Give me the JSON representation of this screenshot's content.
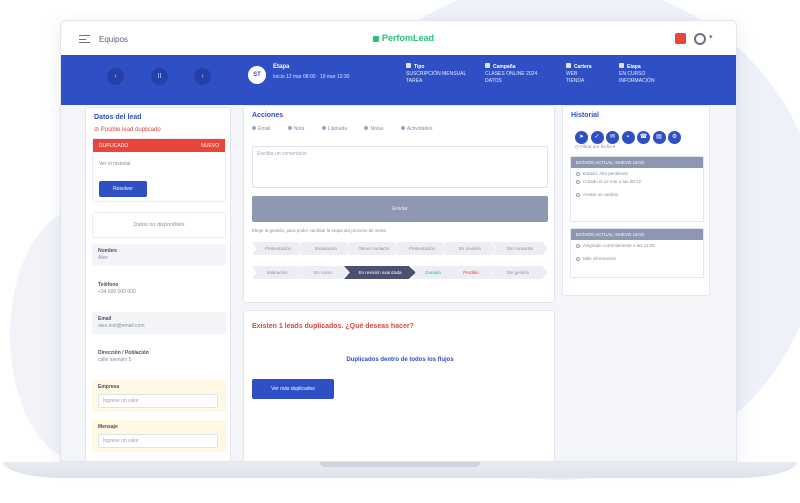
{
  "topbar": {
    "section_title": "Equipos",
    "logo": "PerfomLead"
  },
  "bluebar": {
    "nav": [
      "‹",
      "II",
      "›"
    ],
    "step": {
      "icon": "ST",
      "name": "Etapa",
      "date": "Inicio 12 mar 08:00 · 19 mar 12:30"
    },
    "info": [
      {
        "label": "Tipo",
        "lines": [
          "SUSCRIPCIÓN MENSUAL",
          "TAREA"
        ]
      },
      {
        "label": "Campaña",
        "lines": [
          "CLASES ONLINE 2024",
          "DATOS"
        ]
      },
      {
        "label": "Cartera",
        "lines": [
          "WEB",
          "TIENDA"
        ]
      },
      {
        "label": "Etapa",
        "lines": [
          "EN CURSO",
          "INFORMACIÓN"
        ]
      }
    ]
  },
  "left_panel": {
    "title": "Datos del lead",
    "duplicate_warning": "Posible lead duplicado",
    "duplicate_card": {
      "header": "DUPLICADO",
      "header_right": "NUEVO",
      "text": "Ver el historial",
      "button": "Resolver"
    },
    "empty_text": "Datos no disponibles",
    "fields": [
      {
        "label": "Nombre",
        "value": "Alex"
      },
      {
        "label": "Teléfono",
        "value": "+34 600 000 000"
      },
      {
        "label": "Email",
        "value": "alex.test@email.com"
      },
      {
        "label": "Dirección / Población",
        "value": "calle ejemplo 5"
      }
    ],
    "inputs": [
      {
        "label": "Empresa",
        "placeholder": "Ingrese un valor"
      },
      {
        "label": "Mensaje",
        "placeholder": "Ingrese un valor"
      }
    ]
  },
  "center_panel": {
    "title": "Acciones",
    "tabs": [
      "Email",
      "Nota",
      "Llamada",
      "Notas",
      "Actividades"
    ],
    "textarea_placeholder": "Escriba un comentario",
    "submit": "Enviar",
    "hint": "Elegir la gestión, para poder cambiar la etapa del proceso de venta",
    "stages_row1": [
      "Presentación",
      "Evaluación",
      "Tercer contacto",
      "Presentación",
      "En revisión",
      "Sin contactar"
    ],
    "stages_row2": [
      "Valoración",
      "En curso",
      "En revisión avanzada",
      "Ganado",
      "Perdido",
      "Sin gestión"
    ]
  },
  "bottom_panel": {
    "question": "Existen 1 leads duplicados. ¿Qué deseas hacer?",
    "link": "Duplicados dentro de todos los flujos",
    "button": "Ver más duplicados"
  },
  "right_panel": {
    "title": "Historial",
    "icons": [
      "send-icon",
      "check-icon",
      "mail-icon",
      "chat-icon",
      "phone-icon",
      "doc-icon",
      "gear-icon"
    ],
    "filter": "Filtrar por fecha",
    "cards": [
      {
        "header": "ESTADO ACTUAL: NUEVO LEAD",
        "lines": [
          "Estado: Alta pendiente",
          "Creado el 12 mar a las 09:12",
          "Anotar un cambio"
        ]
      },
      {
        "header": "ESTADO ACTUAL: NUEVO LEAD",
        "lines": [
          "Asignado correctamente a las 11:05",
          "Más información"
        ]
      }
    ]
  },
  "colors": {
    "primary": "#2f4fc4",
    "danger": "#e8453c",
    "success": "#27c27a",
    "muted": "#8d97b1"
  }
}
